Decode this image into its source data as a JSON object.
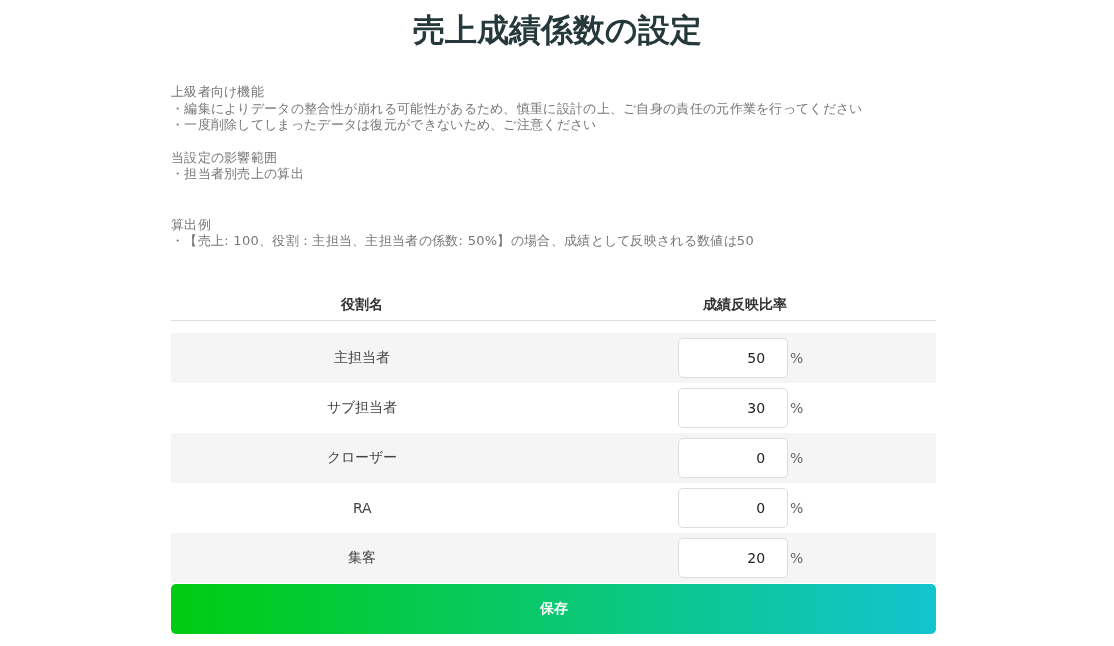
{
  "title": "売上成績係数の設定",
  "notes": [
    {
      "heading": "上級者向け機能",
      "items": [
        "・編集によりデータの整合性が崩れる可能性があるため、慎重に設計の上、ご自身の責任の元作業を行ってください",
        "・一度削除してしまったデータは復元ができないため、ご注意ください"
      ]
    },
    {
      "heading": "当設定の影響範囲",
      "items": [
        "・担当者別売上の算出"
      ]
    },
    {
      "heading": "算出例",
      "items": [
        "・【売上: 100、役割：主担当、主担当者の係数: 50%】の場合、成績として反映される数値は50"
      ]
    }
  ],
  "table": {
    "columns": [
      "役割名",
      "成績反映比率"
    ],
    "rows": [
      {
        "role": "主担当者",
        "value": "50",
        "unit": "%"
      },
      {
        "role": "サブ担当者",
        "value": "30",
        "unit": "%"
      },
      {
        "role": "クローザー",
        "value": "0",
        "unit": "%"
      },
      {
        "role": "RA",
        "value": "0",
        "unit": "%"
      },
      {
        "role": "集客",
        "value": "20",
        "unit": "%"
      }
    ]
  },
  "save_button": "保存"
}
